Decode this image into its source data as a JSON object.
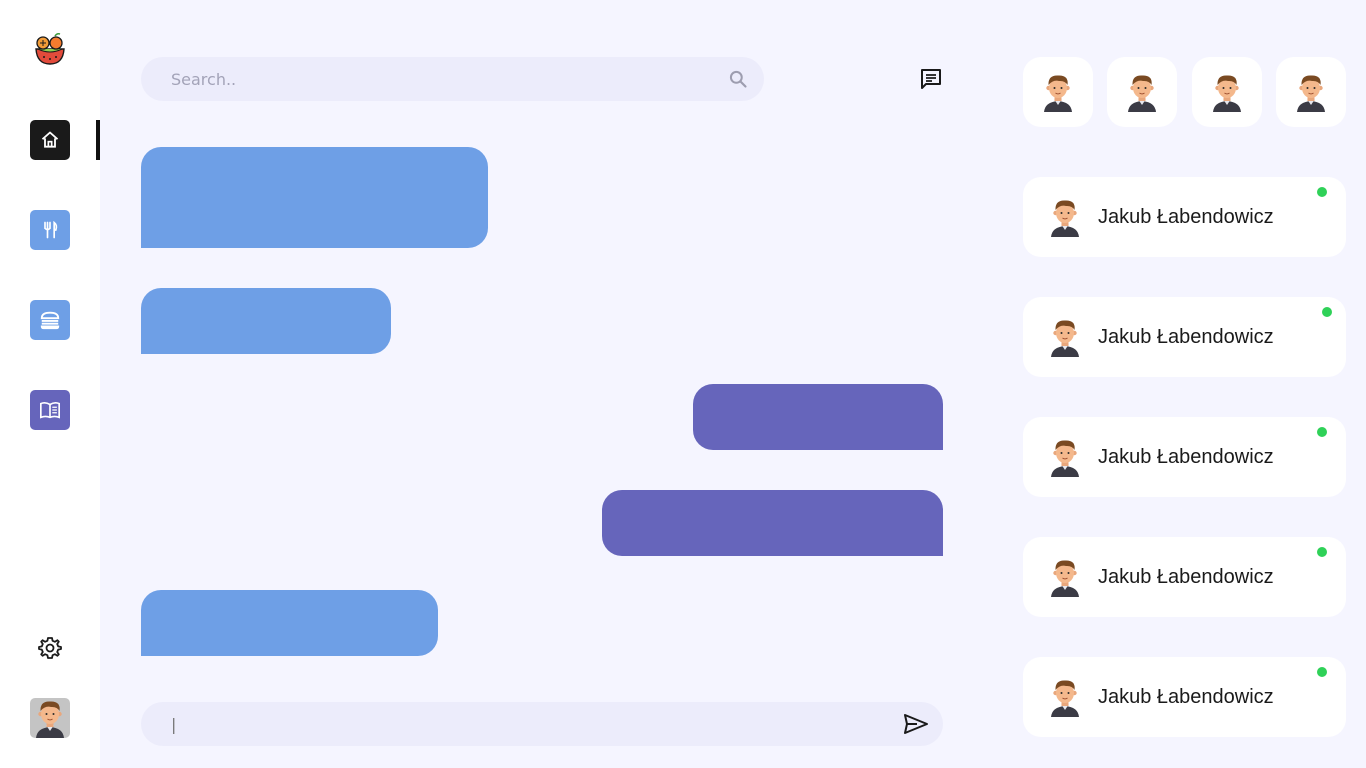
{
  "colors": {
    "background": "#f5f5ff",
    "incoming_bubble": "#6e9fe6",
    "outgoing_bubble": "#6665bb",
    "online": "#2fd158",
    "nav_active": "#1a1a1a",
    "nav_food": "#6e9fe6",
    "nav_recipes": "#6665bb"
  },
  "sidebar": {
    "logo_icon": "fruit-bowl-logo",
    "nav": [
      {
        "id": "home",
        "icon": "home-icon",
        "active": true
      },
      {
        "id": "restaurant",
        "icon": "fork-knife-icon",
        "active": false
      },
      {
        "id": "burger",
        "icon": "burger-icon",
        "active": false
      },
      {
        "id": "recipes",
        "icon": "book-icon",
        "active": false
      }
    ],
    "settings_icon": "gear-icon",
    "avatar_icon": "user-avatar"
  },
  "search": {
    "placeholder": "Search..",
    "icon": "search-icon"
  },
  "header": {
    "new_message_icon": "chat-icon"
  },
  "messages": [
    {
      "direction": "incoming",
      "text": ""
    },
    {
      "direction": "incoming",
      "text": ""
    },
    {
      "direction": "outgoing",
      "text": ""
    },
    {
      "direction": "outgoing",
      "text": ""
    },
    {
      "direction": "incoming",
      "text": ""
    }
  ],
  "compose": {
    "value": "|",
    "send_icon": "send-icon"
  },
  "stories": [
    {
      "icon": "user-avatar"
    },
    {
      "icon": "user-avatar"
    },
    {
      "icon": "user-avatar"
    },
    {
      "icon": "user-avatar"
    }
  ],
  "contacts": [
    {
      "name": "Jakub Łabendowicz",
      "online": true
    },
    {
      "name": "Jakub Łabendowicz",
      "online": true
    },
    {
      "name": "Jakub Łabendowicz",
      "online": true
    },
    {
      "name": "Jakub Łabendowicz",
      "online": true
    },
    {
      "name": "Jakub Łabendowicz",
      "online": true
    }
  ]
}
